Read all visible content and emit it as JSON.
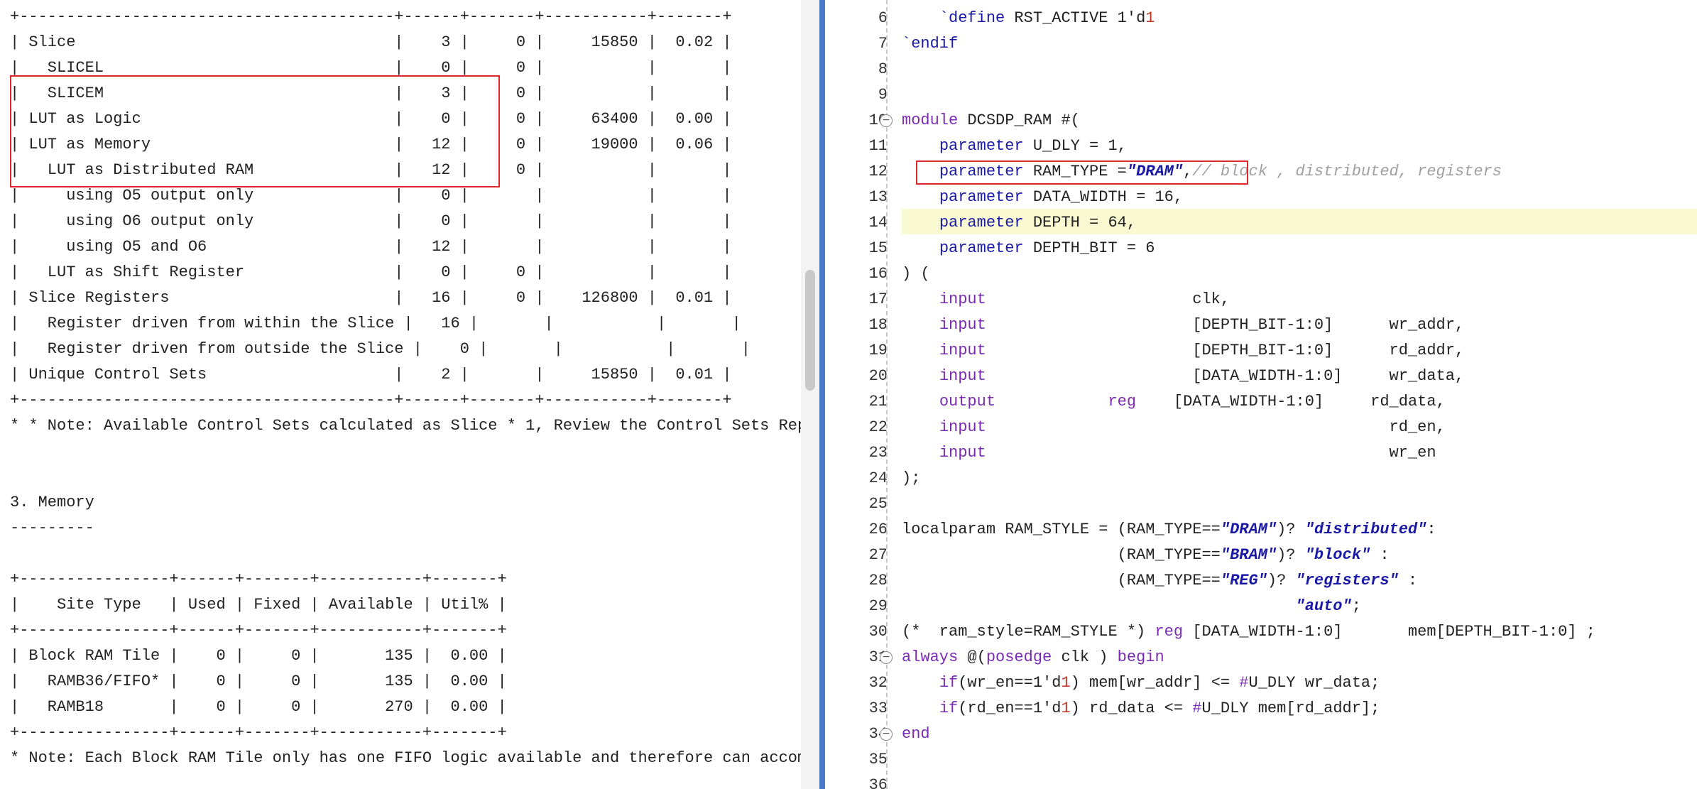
{
  "left_panel": {
    "lines": [
      "+----------------------------------------+------+-------+-----------+-------+",
      "| Slice                                  |    3 |     0 |     15850 |  0.02 |",
      "|   SLICEL                               |    0 |     0 |           |       |",
      "|   SLICEM                               |    3 |     0 |           |       |",
      "| LUT as Logic                           |    0 |     0 |     63400 |  0.00 |",
      "| LUT as Memory                          |   12 |     0 |     19000 |  0.06 |",
      "|   LUT as Distributed RAM               |   12 |     0 |           |       |",
      "|     using O5 output only               |    0 |       |           |       |",
      "|     using O6 output only               |    0 |       |           |       |",
      "|     using O5 and O6                    |   12 |       |           |       |",
      "|   LUT as Shift Register                |    0 |     0 |           |       |",
      "| Slice Registers                        |   16 |     0 |    126800 |  0.01 |",
      "|   Register driven from within the Slice |   16 |       |           |       |",
      "|   Register driven from outside the Slice |    0 |       |           |       |",
      "| Unique Control Sets                    |    2 |       |     15850 |  0.01 |",
      "+----------------------------------------+------+-------+-----------+-------+",
      "* * Note: Available Control Sets calculated as Slice * 1, Review the Control Sets Report for",
      "",
      "",
      "3. Memory",
      "---------",
      "",
      "+----------------+------+-------+-----------+-------+",
      "|    Site Type   | Used | Fixed | Available | Util% |",
      "+----------------+------+-------+-----------+-------+",
      "| Block RAM Tile |    0 |     0 |       135 |  0.00 |",
      "|   RAMB36/FIFO* |    0 |     0 |       135 |  0.00 |",
      "|   RAMB18       |    0 |     0 |       270 |  0.00 |",
      "+----------------+------+-------+-----------+-------+",
      "* Note: Each Block RAM Tile only has one FIFO logic available and therefore can accommodate o"
    ]
  },
  "right_panel": {
    "line_numbers": [
      "6",
      "7",
      "8",
      "9",
      "10",
      "11",
      "12",
      "13",
      "14",
      "15",
      "16",
      "17",
      "18",
      "19",
      "20",
      "21",
      "22",
      "23",
      "24",
      "25",
      "26",
      "27",
      "28",
      "29",
      "30",
      "31",
      "32",
      "33",
      "34",
      "35",
      "36"
    ],
    "code": [
      [
        {
          "t": "    "
        },
        {
          "t": "`define",
          "c": "kwb"
        },
        {
          "t": " RST_ACTIVE 1'd"
        },
        {
          "t": "1",
          "c": "num2"
        }
      ],
      [
        {
          "t": "`endif",
          "c": "kwb"
        }
      ],
      [],
      [],
      [
        {
          "t": "module",
          "c": "kw"
        },
        {
          "t": " DCSDP_RAM #("
        }
      ],
      [
        {
          "t": "    "
        },
        {
          "t": "parameter",
          "c": "kwb"
        },
        {
          "t": " U_DLY = 1,"
        }
      ],
      [
        {
          "t": "    "
        },
        {
          "t": "parameter",
          "c": "kwb"
        },
        {
          "t": " RAM_TYPE ="
        },
        {
          "t": "\"DRAM\"",
          "c": "str"
        },
        {
          "t": ","
        },
        {
          "t": "// block , distributed, registers",
          "c": "cmt"
        }
      ],
      [
        {
          "t": "    "
        },
        {
          "t": "parameter",
          "c": "kwb"
        },
        {
          "t": " DATA_WIDTH = 16,"
        }
      ],
      [
        {
          "t": "    "
        },
        {
          "t": "parameter",
          "c": "kwb"
        },
        {
          "t": " DEPTH = 64,"
        }
      ],
      [
        {
          "t": "    "
        },
        {
          "t": "parameter",
          "c": "kwb"
        },
        {
          "t": " DEPTH_BIT = 6"
        }
      ],
      [
        {
          "t": ") ("
        }
      ],
      [
        {
          "t": "    "
        },
        {
          "t": "input",
          "c": "kw"
        },
        {
          "t": "                      clk,"
        }
      ],
      [
        {
          "t": "    "
        },
        {
          "t": "input",
          "c": "kw"
        },
        {
          "t": "                      [DEPTH_BIT-1:0]      wr_addr,"
        }
      ],
      [
        {
          "t": "    "
        },
        {
          "t": "input",
          "c": "kw"
        },
        {
          "t": "                      [DEPTH_BIT-1:0]      rd_addr,"
        }
      ],
      [
        {
          "t": "    "
        },
        {
          "t": "input",
          "c": "kw"
        },
        {
          "t": "                      [DATA_WIDTH-1:0]     wr_data,"
        }
      ],
      [
        {
          "t": "    "
        },
        {
          "t": "output",
          "c": "kw"
        },
        {
          "t": "            "
        },
        {
          "t": "reg",
          "c": "kw"
        },
        {
          "t": "    [DATA_WIDTH-1:0]     rd_data,"
        }
      ],
      [
        {
          "t": "    "
        },
        {
          "t": "input",
          "c": "kw"
        },
        {
          "t": "                                           rd_en,"
        }
      ],
      [
        {
          "t": "    "
        },
        {
          "t": "input",
          "c": "kw"
        },
        {
          "t": "                                           wr_en"
        }
      ],
      [
        {
          "t": ");"
        }
      ],
      [],
      [
        {
          "t": "localparam RAM_STYLE = (RAM_TYPE=="
        },
        {
          "t": "\"DRAM\"",
          "c": "str"
        },
        {
          "t": ")? "
        },
        {
          "t": "\"distributed\"",
          "c": "str"
        },
        {
          "t": ":"
        }
      ],
      [
        {
          "t": "                       (RAM_TYPE=="
        },
        {
          "t": "\"BRAM\"",
          "c": "str"
        },
        {
          "t": ")? "
        },
        {
          "t": "\"block\"",
          "c": "str"
        },
        {
          "t": " :"
        }
      ],
      [
        {
          "t": "                       (RAM_TYPE=="
        },
        {
          "t": "\"REG\"",
          "c": "str"
        },
        {
          "t": ")? "
        },
        {
          "t": "\"registers\"",
          "c": "str"
        },
        {
          "t": " :"
        }
      ],
      [
        {
          "t": "                                          "
        },
        {
          "t": "\"auto\"",
          "c": "str"
        },
        {
          "t": ";"
        }
      ],
      [
        {
          "t": "(*  ram_style=RAM_STYLE *) "
        },
        {
          "t": "reg",
          "c": "kw"
        },
        {
          "t": " [DATA_WIDTH-1:0]       mem[DEPTH_BIT-1:0] ;"
        }
      ],
      [
        {
          "t": "always",
          "c": "kw"
        },
        {
          "t": " @("
        },
        {
          "t": "posedge",
          "c": "kw"
        },
        {
          "t": " clk ) "
        },
        {
          "t": "begin",
          "c": "kw"
        }
      ],
      [
        {
          "t": "    "
        },
        {
          "t": "if",
          "c": "kw"
        },
        {
          "t": "(wr_en==1'd"
        },
        {
          "t": "1",
          "c": "num2"
        },
        {
          "t": ") mem[wr_addr] <= "
        },
        {
          "t": "#",
          "c": "kw"
        },
        {
          "t": "U_DLY wr_data;"
        }
      ],
      [
        {
          "t": "    "
        },
        {
          "t": "if",
          "c": "kw"
        },
        {
          "t": "(rd_en==1'd"
        },
        {
          "t": "1",
          "c": "num2"
        },
        {
          "t": ") rd_data <= "
        },
        {
          "t": "#",
          "c": "kw"
        },
        {
          "t": "U_DLY mem[rd_addr];"
        }
      ],
      [
        {
          "t": "end",
          "c": "kw"
        }
      ],
      [],
      []
    ],
    "fold_markers": [
      "minus",
      "minus",
      "minus"
    ]
  },
  "colors": {
    "highlight_box": "#e0262a",
    "current_line": "#fafad2",
    "divider": "#4a78c8"
  }
}
